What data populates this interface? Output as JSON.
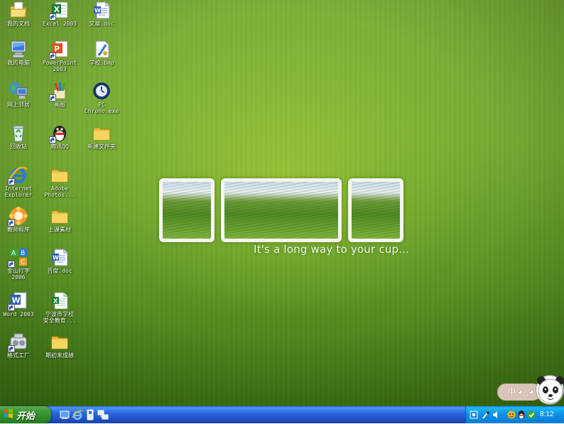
{
  "desktop": {
    "icons": [
      {
        "label": "我的文档",
        "icon": "my-documents-icon"
      },
      {
        "label": "Excel 2003",
        "icon": "excel-icon"
      },
      {
        "label": "文章.doc",
        "icon": "word-doc-icon"
      },
      {
        "label": "我的电脑",
        "icon": "my-computer-icon"
      },
      {
        "label": "PowerPoint\n2003",
        "icon": "powerpoint-icon"
      },
      {
        "label": "学校.bmp",
        "icon": "bmp-image-icon"
      },
      {
        "label": "网上邻居",
        "icon": "network-places-icon"
      },
      {
        "label": "画图",
        "icon": "paint-icon"
      },
      {
        "label": "PC\nChrono.exe",
        "icon": "clock-app-icon"
      },
      {
        "label": "回收站",
        "icon": "recycle-bin-icon"
      },
      {
        "label": "腾讯QQ",
        "icon": "qq-penguin-icon"
      },
      {
        "label": "新建文件夹",
        "icon": "folder-icon"
      },
      {
        "label": "Internet\nExplorer",
        "icon": "internet-explorer-icon"
      },
      {
        "label": "Adobe\nPhotos...",
        "icon": "folder-icon"
      },
      {
        "label": "教师程序",
        "icon": "teacher-app-icon"
      },
      {
        "label": "上课素材",
        "icon": "folder-icon"
      },
      {
        "label": "金山打字\n2006",
        "icon": "typing-tutor-icon"
      },
      {
        "label": "百度.doc",
        "icon": "word-doc-icon"
      },
      {
        "label": "Word 2003",
        "icon": "word-icon"
      },
      {
        "label": "宁波市学校\n安全教育...",
        "icon": "excel-doc-icon"
      },
      {
        "label": "格式工厂",
        "icon": "format-factory-icon"
      },
      {
        "label": "期初末成绩",
        "icon": "folder-icon"
      }
    ]
  },
  "wallpaper": {
    "slogan": "It's a long way to your cup..."
  },
  "taskbar": {
    "start_label": "开始",
    "quick_launch": [
      "show-desktop-icon",
      "internet-explorer-icon",
      "media-icon",
      "network-icon"
    ],
    "tray_icons": [
      "safely-remove-icon",
      "pen-icon",
      "volume-icon",
      "input-method-icon",
      "qq-tray-icon",
      "network-tray-icon"
    ],
    "clock": "8:12"
  },
  "widget": {
    "bubble_text": "中 ◕‿◕"
  },
  "colors": {
    "desktop_green": "#76ab33",
    "taskbar_blue": "#245edc",
    "start_green": "#3c9a34",
    "tray_blue": "#0d8ee6"
  }
}
